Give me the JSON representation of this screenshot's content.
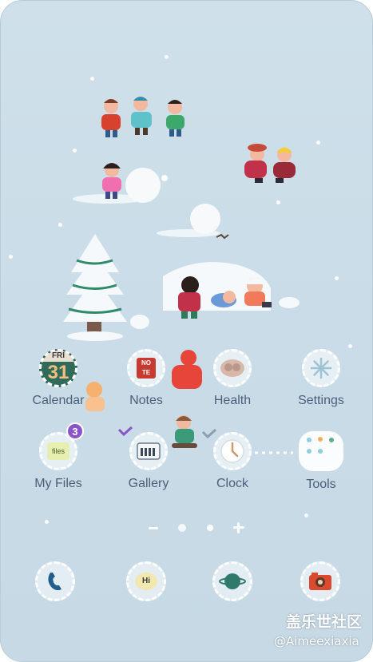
{
  "apps_row1": [
    {
      "id": "calendar",
      "label": "Calendar",
      "icon": "calendar-icon",
      "detail_day": "FRI",
      "detail_date": "31"
    },
    {
      "id": "notes",
      "label": "Notes",
      "icon": "notes-icon",
      "detail_text": "NO TE"
    },
    {
      "id": "health",
      "label": "Health",
      "icon": "health-icon"
    },
    {
      "id": "settings",
      "label": "Settings",
      "icon": "settings-icon"
    }
  ],
  "apps_row2": [
    {
      "id": "myfiles",
      "label": "My Files",
      "icon": "folder-icon",
      "badge": "3",
      "detail_text": "files"
    },
    {
      "id": "gallery",
      "label": "Gallery",
      "icon": "gallery-icon"
    },
    {
      "id": "clock",
      "label": "Clock",
      "icon": "clock-icon"
    },
    {
      "id": "tools",
      "label": "Tools",
      "icon": "tools-folder-icon"
    }
  ],
  "dock": [
    {
      "id": "phone",
      "icon": "phone-icon"
    },
    {
      "id": "messages",
      "icon": "messages-icon",
      "detail_text": "Hi"
    },
    {
      "id": "internet",
      "icon": "internet-icon"
    },
    {
      "id": "camera",
      "icon": "camera-icon"
    }
  ],
  "page_indicator": {
    "left": "minus-icon",
    "home": "home-dot-icon",
    "current": "page-dot-icon",
    "right": "plus-icon"
  },
  "watermark": {
    "site": "盖乐世社区",
    "user": "@Aimeexiaxia"
  },
  "colors": {
    "background": "#cfe0ea",
    "label": "#4a5f7a",
    "badge": "#8a54c8",
    "accent_red": "#d94a3c",
    "accent_green": "#3a9a7a"
  }
}
